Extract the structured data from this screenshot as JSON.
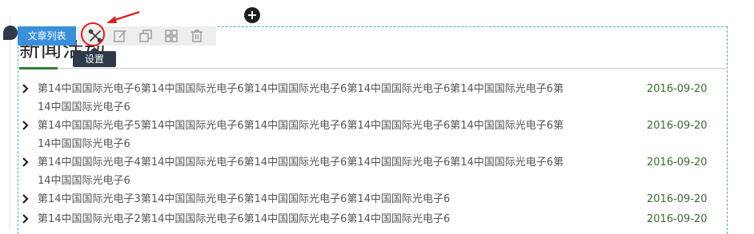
{
  "editor": {
    "module_tag": "文章列表",
    "tooltip": "设置",
    "add_symbol": "+"
  },
  "toolbar": {
    "icons": [
      "settings-tools-icon",
      "edit-icon",
      "copy-icon",
      "grid-layout-icon",
      "delete-icon"
    ]
  },
  "colors": {
    "accent": "#3a8fd9",
    "date": "#3b6b2f",
    "highlight": "#e02020",
    "tooltip_bg": "#2e3a4a"
  },
  "module": {
    "title": "新闻活动",
    "news": [
      {
        "title": "第14中国国际光电子6第14中国国际光电子6第14中国国际光电子6第14中国国际光电子6第14中国国际光电子6第14中国国际光电子6",
        "date": "2016-09-20"
      },
      {
        "title": "第14中国国际光电子5第14中国国际光电子6第14中国国际光电子6第14中国国际光电子6第14中国国际光电子6第14中国国际光电子6",
        "date": "2016-09-20"
      },
      {
        "title": "第14中国国际光电子4第14中国国际光电子6第14中国国际光电子6第14中国国际光电子6第14中国国际光电子6第14中国国际光电子6",
        "date": "2016-09-20"
      },
      {
        "title": "第14中国国际光电子3第14中国国际光电子6第14中国国际光电子6第14中国国际光电子6",
        "date": "2016-09-20"
      },
      {
        "title": "第14中国国际光电子2第14中国国际光电子6第14中国国际光电子6第14中国国际光电子6",
        "date": "2016-09-20"
      }
    ]
  }
}
